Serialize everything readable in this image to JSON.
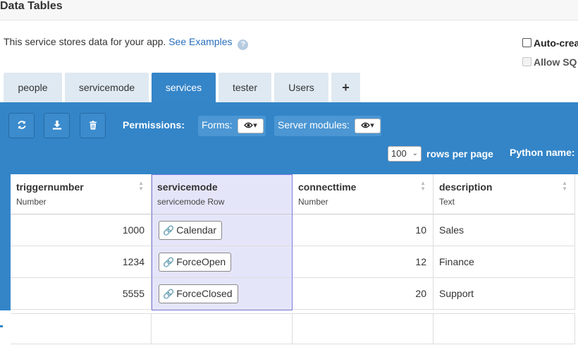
{
  "header": {
    "title": "Data Tables"
  },
  "intro": {
    "text": "This service stores data for your app.",
    "link": "See Examples",
    "help_glyph": "?"
  },
  "options": {
    "auto_create": "Auto-crea",
    "allow_sql": "Allow SQ"
  },
  "tabs": [
    {
      "label": "people",
      "active": false
    },
    {
      "label": "servicemode",
      "active": false
    },
    {
      "label": "services",
      "active": true
    },
    {
      "label": "tester",
      "active": false
    },
    {
      "label": "Users",
      "active": false
    }
  ],
  "add_tab_glyph": "+",
  "toolbar": {
    "refresh_icon": "refresh-icon",
    "download_icon": "download-icon",
    "delete_icon": "trash-icon",
    "permissions_label": "Permissions:",
    "forms_label": "Forms:",
    "server_modules_label": "Server modules:",
    "forms_value_icon": "eye-icon",
    "server_value_icon": "eye-icon",
    "rows_per_page_value": "100",
    "rows_per_page_label": "rows per page",
    "python_name_label": "Python name:"
  },
  "columns": [
    {
      "name": "triggernumber",
      "type": "Number"
    },
    {
      "name": "servicemode",
      "type": "servicemode Row"
    },
    {
      "name": "connecttime",
      "type": "Number"
    },
    {
      "name": "description",
      "type": "Text"
    }
  ],
  "rows": [
    {
      "triggernumber": "1000",
      "servicemode": "Calendar",
      "connecttime": "10",
      "description": "Sales"
    },
    {
      "triggernumber": "1234",
      "servicemode": "ForceOpen",
      "connecttime": "12",
      "description": "Finance"
    },
    {
      "triggernumber": "5555",
      "servicemode": "ForceClosed",
      "connecttime": "20",
      "description": "Support"
    }
  ],
  "colors": {
    "toolbar": "#3385c8",
    "active_tab": "#3585c9",
    "inactive_tab": "#dfe9f2",
    "highlight_column": "#e5e5fa",
    "link": "#2a6ebb"
  }
}
